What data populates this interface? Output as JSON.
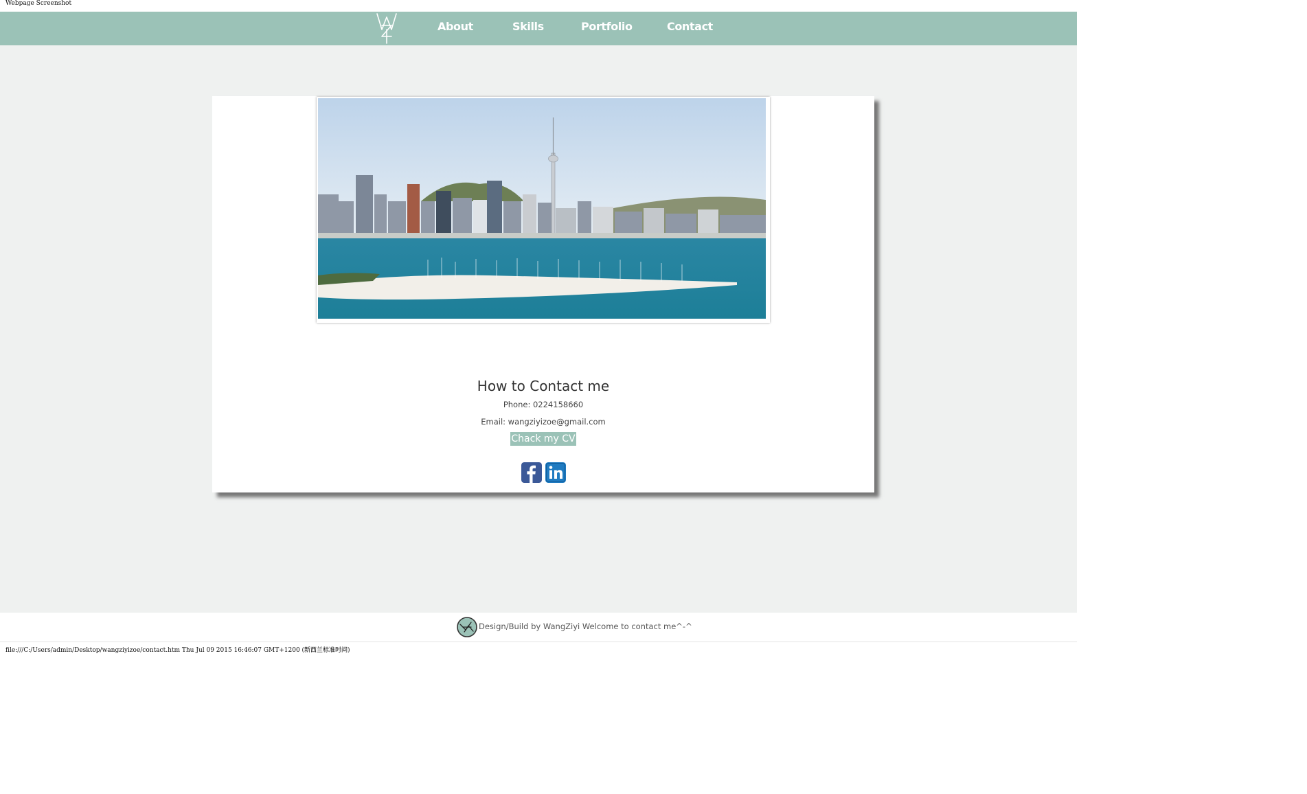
{
  "browser": {
    "caption": "Webpage Screenshot",
    "status_line": "file:///C:/Users/admin/Desktop/wangziyizoe/contact.htm Thu Jul 09 2015 16:46:07 GMT+1200 (新西兰标准时间)"
  },
  "nav": {
    "logo": "W-Z-logo-icon",
    "items": [
      {
        "label": "About"
      },
      {
        "label": "Skills"
      },
      {
        "label": "Portfolio"
      },
      {
        "label": "Contact"
      }
    ]
  },
  "contact": {
    "heading": "How to Contact me",
    "phone": "Phone: 0224158660",
    "email": "Email: wangziyizoe@gmail.com",
    "cv_button": "Chack my CV",
    "social": [
      {
        "icon": "facebook-icon",
        "color": "#3b5998"
      },
      {
        "icon": "linkedin-icon",
        "color": "#1f7bc1"
      }
    ]
  },
  "footer": {
    "text": "Design/Build by WangZiyi Welcome to contact me^-^"
  },
  "colors": {
    "accent": "#9bc2b7",
    "page_bg": "#eff1f0",
    "card_bg": "#ffffff"
  }
}
